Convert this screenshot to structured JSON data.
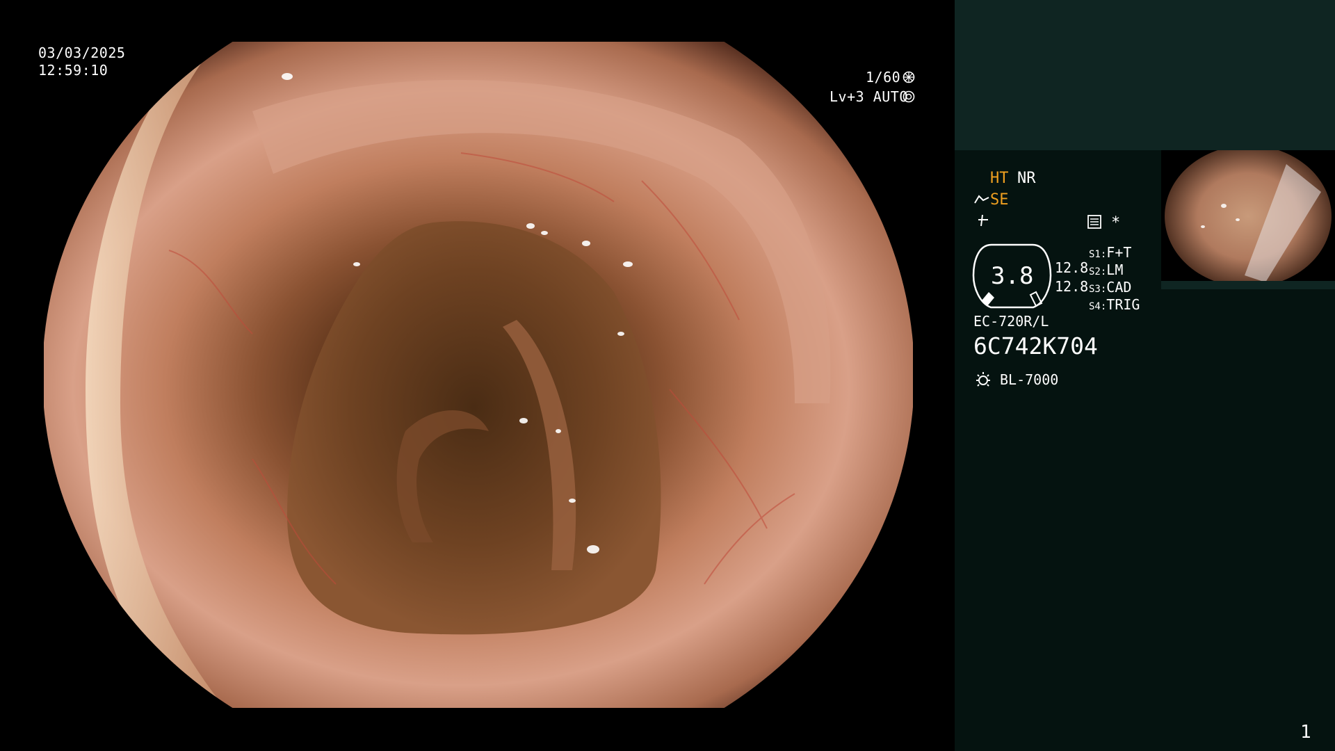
{
  "overlay": {
    "date": "03/03/2025",
    "time": "12:59:10",
    "shutter": "1/60",
    "shutter_icon": "shutter-icon",
    "level_mode": "Lv+3 AUTO",
    "mode_icon": "iris-icon"
  },
  "panel": {
    "ht": "HT",
    "nr": "NR",
    "se": "SE",
    "se_icon": "scope-se-icon",
    "mode_icon": "freeze-icon",
    "menu_icon": "structure-icon",
    "asterisk": "*",
    "gauge_value": "3.8",
    "gauge_side_values": [
      "12.8",
      "12.8"
    ],
    "switches": [
      {
        "key": "S1:",
        "value": "F+T"
      },
      {
        "key": "S2:",
        "value": "LM"
      },
      {
        "key": "S3:",
        "value": "CAD"
      },
      {
        "key": "S4:",
        "value": "TRIG"
      }
    ],
    "scope_model": "EC-720R/L",
    "scope_serial": "6C742K704",
    "light_icon": "light-source-icon",
    "light_source": "BL-7000",
    "page_number": "1"
  },
  "colors": {
    "side_top_bg": "#0f2522",
    "side_main_bg": "#051310",
    "accent_orange": "#f0a020"
  }
}
